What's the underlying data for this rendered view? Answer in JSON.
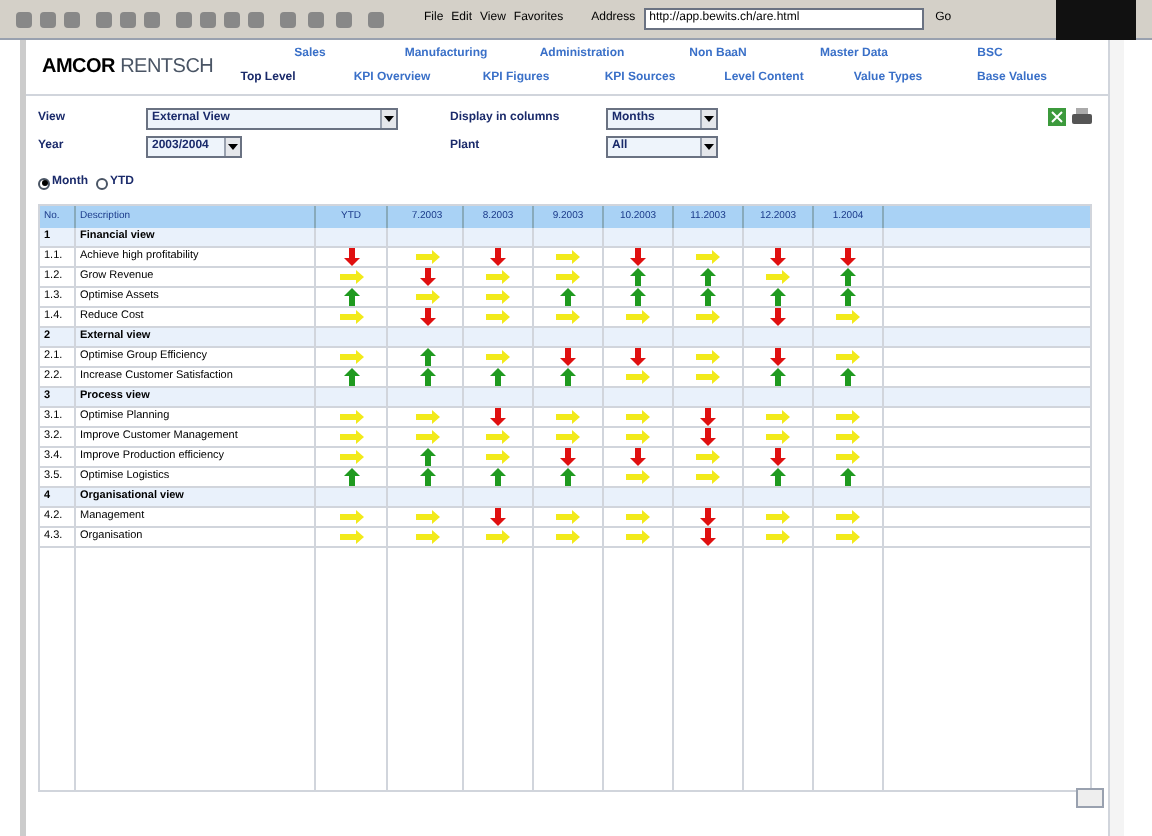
{
  "browser": {
    "menu": [
      "File",
      "Edit",
      "View",
      "Favorites"
    ],
    "address_label": "Address",
    "address": "http://app.bewits.ch/are.html",
    "go": "Go"
  },
  "header": {
    "logo_bold": "AMCOR",
    "logo_light": "RENTSCH",
    "top_nav": [
      {
        "label": "Sales"
      },
      {
        "label": "Manufacturing"
      },
      {
        "label": "Administration"
      },
      {
        "label": "Non BaaN"
      },
      {
        "label": "Master Data"
      },
      {
        "label": "BSC"
      }
    ],
    "sub_nav": [
      {
        "label": "Top Level",
        "selected": true
      },
      {
        "label": "KPI Overview",
        "selected": false
      },
      {
        "label": "KPI Figures",
        "selected": false
      },
      {
        "label": "KPI Sources",
        "selected": false
      },
      {
        "label": "Level Content",
        "selected": false
      },
      {
        "label": "Value Types",
        "selected": false
      },
      {
        "label": "Base Values",
        "selected": false
      }
    ]
  },
  "filters": {
    "view_label": "View",
    "view": "External View",
    "year_label": "Year",
    "year": "2003/2004",
    "columns_label": "Display in columns",
    "columns": "Months",
    "plant_label": "Plant",
    "plant": "All"
  },
  "mode": [
    {
      "label": "Month",
      "selected": true
    },
    {
      "label": "YTD",
      "selected": false
    }
  ],
  "table": {
    "columns": [
      "No.",
      "Description",
      "YTD",
      "7.2003",
      "8.2003",
      "9.2003",
      "10.2003",
      "11.2003",
      "12.2003",
      "1.2004"
    ],
    "rows": [
      {
        "kind": "group",
        "no": "1",
        "description": "Financial view"
      },
      {
        "kind": "item",
        "no": "1.1.",
        "description": "Achieve high profitability",
        "cells": [
          {
            "kind": "down"
          },
          {
            "kind": "flat"
          },
          {
            "kind": "down"
          },
          {
            "kind": "flat"
          },
          {
            "kind": "down"
          },
          {
            "kind": "flat"
          },
          {
            "kind": "down"
          },
          {
            "kind": "down"
          }
        ]
      },
      {
        "kind": "item",
        "no": "1.2.",
        "description": "Grow Revenue",
        "cells": [
          {
            "kind": "flat"
          },
          {
            "kind": "down"
          },
          {
            "kind": "flat"
          },
          {
            "kind": "flat"
          },
          {
            "kind": "up"
          },
          {
            "kind": "up"
          },
          {
            "kind": "flat"
          },
          {
            "kind": "up"
          }
        ]
      },
      {
        "kind": "item",
        "no": "1.3.",
        "description": "Optimise Assets",
        "cells": [
          {
            "kind": "up"
          },
          {
            "kind": "flat"
          },
          {
            "kind": "flat"
          },
          {
            "kind": "up"
          },
          {
            "kind": "up"
          },
          {
            "kind": "up"
          },
          {
            "kind": "up"
          },
          {
            "kind": "up"
          }
        ]
      },
      {
        "kind": "item",
        "no": "1.4.",
        "description": "Reduce Cost",
        "cells": [
          {
            "kind": "flat"
          },
          {
            "kind": "down"
          },
          {
            "kind": "flat"
          },
          {
            "kind": "flat"
          },
          {
            "kind": "flat"
          },
          {
            "kind": "flat"
          },
          {
            "kind": "down"
          },
          {
            "kind": "flat"
          }
        ]
      },
      {
        "kind": "group",
        "no": "2",
        "description": "External view"
      },
      {
        "kind": "item",
        "no": "2.1.",
        "description": "Optimise Group Efficiency",
        "cells": [
          {
            "kind": "flat"
          },
          {
            "kind": "up"
          },
          {
            "kind": "flat"
          },
          {
            "kind": "down"
          },
          {
            "kind": "down"
          },
          {
            "kind": "flat"
          },
          {
            "kind": "down"
          },
          {
            "kind": "flat"
          }
        ]
      },
      {
        "kind": "item",
        "no": "2.2.",
        "description": "Increase Customer Satisfaction",
        "cells": [
          {
            "kind": "up"
          },
          {
            "kind": "up"
          },
          {
            "kind": "up"
          },
          {
            "kind": "up"
          },
          {
            "kind": "flat"
          },
          {
            "kind": "flat"
          },
          {
            "kind": "up"
          },
          {
            "kind": "up"
          }
        ]
      },
      {
        "kind": "group",
        "no": "3",
        "description": "Process view"
      },
      {
        "kind": "item",
        "no": "3.1.",
        "description": "Optimise Planning",
        "cells": [
          {
            "kind": "flat"
          },
          {
            "kind": "flat"
          },
          {
            "kind": "down"
          },
          {
            "kind": "flat"
          },
          {
            "kind": "flat"
          },
          {
            "kind": "down"
          },
          {
            "kind": "flat"
          },
          {
            "kind": "flat"
          }
        ]
      },
      {
        "kind": "item",
        "no": "3.2.",
        "description": "Improve Customer Management",
        "cells": [
          {
            "kind": "flat"
          },
          {
            "kind": "flat"
          },
          {
            "kind": "flat"
          },
          {
            "kind": "flat"
          },
          {
            "kind": "flat"
          },
          {
            "kind": "down"
          },
          {
            "kind": "flat"
          },
          {
            "kind": "flat"
          }
        ]
      },
      {
        "kind": "item",
        "no": "3.4.",
        "description": "Improve Production efficiency",
        "cells": [
          {
            "kind": "flat"
          },
          {
            "kind": "up"
          },
          {
            "kind": "flat"
          },
          {
            "kind": "down"
          },
          {
            "kind": "down"
          },
          {
            "kind": "flat"
          },
          {
            "kind": "down"
          },
          {
            "kind": "flat"
          }
        ]
      },
      {
        "kind": "item",
        "no": "3.5.",
        "description": "Optimise Logistics",
        "cells": [
          {
            "kind": "up"
          },
          {
            "kind": "up"
          },
          {
            "kind": "up"
          },
          {
            "kind": "up"
          },
          {
            "kind": "flat"
          },
          {
            "kind": "flat"
          },
          {
            "kind": "up"
          },
          {
            "kind": "up"
          }
        ]
      },
      {
        "kind": "group",
        "no": "4",
        "description": "Organisational view"
      },
      {
        "kind": "item",
        "no": "4.2.",
        "description": "Management",
        "cells": [
          {
            "kind": "flat"
          },
          {
            "kind": "flat"
          },
          {
            "kind": "down"
          },
          {
            "kind": "flat"
          },
          {
            "kind": "flat"
          },
          {
            "kind": "down"
          },
          {
            "kind": "flat"
          },
          {
            "kind": "flat"
          }
        ]
      },
      {
        "kind": "item",
        "no": "4.3.",
        "description": "Organisation",
        "cells": [
          {
            "kind": "flat"
          },
          {
            "kind": "flat"
          },
          {
            "kind": "flat"
          },
          {
            "kind": "flat"
          },
          {
            "kind": "flat"
          },
          {
            "kind": "down"
          },
          {
            "kind": "flat"
          },
          {
            "kind": "flat"
          }
        ]
      }
    ]
  }
}
